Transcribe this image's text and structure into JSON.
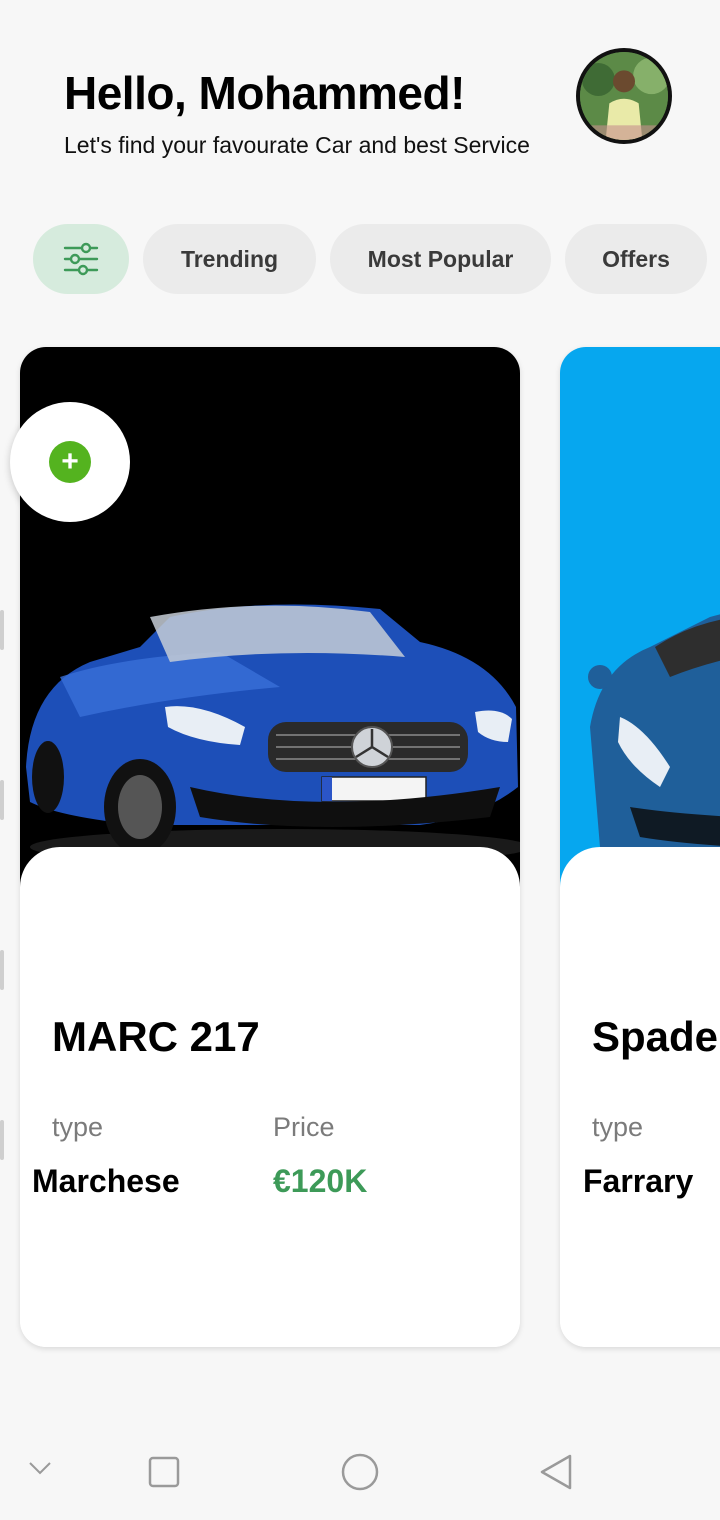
{
  "header": {
    "greeting": "Hello, Mohammed!",
    "subtitle": "Let's find your favourate Car and best Service"
  },
  "chips": [
    {
      "label": "Trending"
    },
    {
      "label": "Most Popular"
    },
    {
      "label": "Offers"
    }
  ],
  "cards": [
    {
      "name": "MARC 217",
      "type_label": "type",
      "type_value": "Marchese",
      "price_label": "Price",
      "price_value": "€120K",
      "bg_color": "#000000",
      "car_color": "#1d4fb8"
    },
    {
      "name": "Spade",
      "type_label": "type",
      "type_value": "Farrary",
      "bg_color": "#06a7ef",
      "car_color": "#1f5f9a"
    }
  ],
  "add_button": {
    "icon": "plus-icon",
    "color": "#54b31f"
  },
  "navbar": {
    "icons": [
      "chevron-down-icon",
      "square-icon",
      "circle-icon",
      "back-triangle-icon"
    ]
  },
  "colors": {
    "price": "#3d9a58",
    "filter_chip": "#d6ebdd",
    "chip": "#ebebeb"
  }
}
